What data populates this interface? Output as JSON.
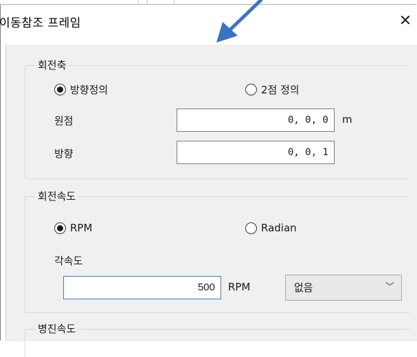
{
  "dialog": {
    "title": "이동참조 프레임",
    "close": "✕"
  },
  "rotation_axis": {
    "legend": "회전축",
    "radio_direction": "방향정의",
    "radio_two_point": "2점 정의",
    "origin_label": "원점",
    "origin_value": "0, 0, 0",
    "origin_unit": "m",
    "direction_label": "방향",
    "direction_value": "0, 0, 1"
  },
  "rotation_speed": {
    "legend": "회전속도",
    "radio_rpm": "RPM",
    "radio_radian": "Radian",
    "angular_label": "각속도",
    "angular_value": "500",
    "angular_unit": "RPM",
    "dropdown_value": "없음"
  },
  "translation_speed": {
    "legend": "병진속도"
  },
  "accent_color": "#3c7fb1",
  "arrow_color": "#3a72c4"
}
